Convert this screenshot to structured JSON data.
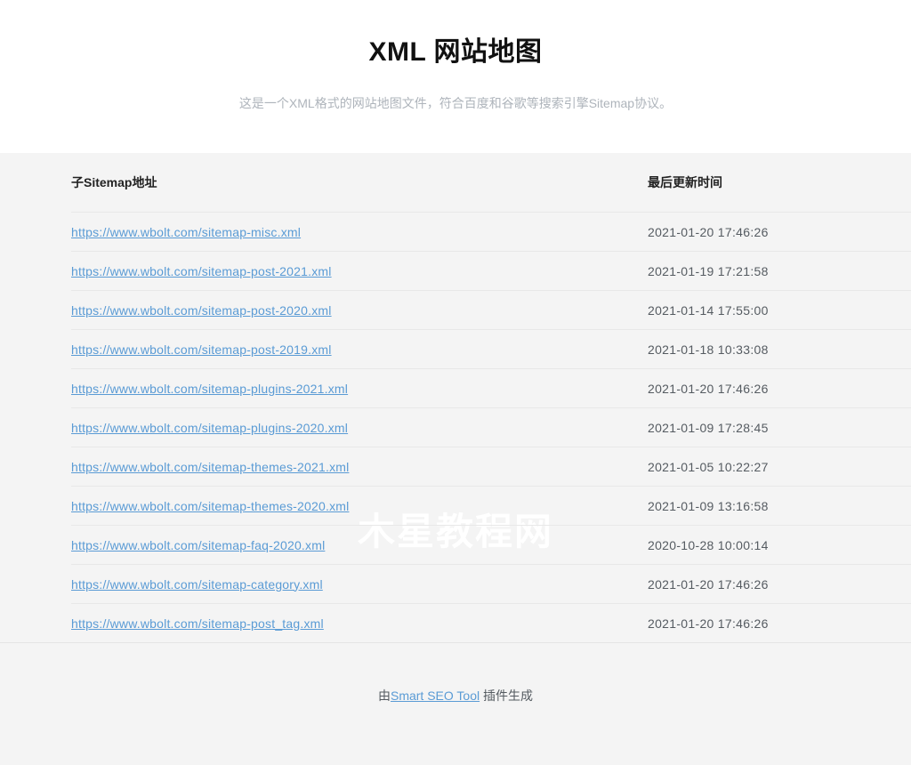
{
  "header": {
    "title": "XML 网站地图",
    "subtitle": "这是一个XML格式的网站地图文件，符合百度和谷歌等搜索引擎Sitemap协议。"
  },
  "table": {
    "columns": [
      "子Sitemap地址",
      "最后更新时间"
    ],
    "rows": [
      {
        "url": "https://www.wbolt.com/sitemap-misc.xml",
        "lastmod": "2021-01-20 17:46:26"
      },
      {
        "url": "https://www.wbolt.com/sitemap-post-2021.xml",
        "lastmod": "2021-01-19 17:21:58"
      },
      {
        "url": "https://www.wbolt.com/sitemap-post-2020.xml",
        "lastmod": "2021-01-14 17:55:00"
      },
      {
        "url": "https://www.wbolt.com/sitemap-post-2019.xml",
        "lastmod": "2021-01-18 10:33:08"
      },
      {
        "url": "https://www.wbolt.com/sitemap-plugins-2021.xml",
        "lastmod": "2021-01-20 17:46:26"
      },
      {
        "url": "https://www.wbolt.com/sitemap-plugins-2020.xml",
        "lastmod": "2021-01-09 17:28:45"
      },
      {
        "url": "https://www.wbolt.com/sitemap-themes-2021.xml",
        "lastmod": "2021-01-05 10:22:27"
      },
      {
        "url": "https://www.wbolt.com/sitemap-themes-2020.xml",
        "lastmod": "2021-01-09 13:16:58"
      },
      {
        "url": "https://www.wbolt.com/sitemap-faq-2020.xml",
        "lastmod": "2020-10-28 10:00:14"
      },
      {
        "url": "https://www.wbolt.com/sitemap-category.xml",
        "lastmod": "2021-01-20 17:46:26"
      },
      {
        "url": "https://www.wbolt.com/sitemap-post_tag.xml",
        "lastmod": "2021-01-20 17:46:26"
      }
    ]
  },
  "footer": {
    "prefix": "由",
    "link_label": "Smart SEO Tool",
    "suffix": " 插件生成"
  },
  "watermark": {
    "text": "木星教程网"
  },
  "colors": {
    "link": "#5a9bd5",
    "page_background": "#f4f4f4",
    "header_background": "#ffffff",
    "subtitle_text": "#aeb4bb",
    "row_border": "#e8e8e8",
    "watermark_text": "#ffffff"
  }
}
